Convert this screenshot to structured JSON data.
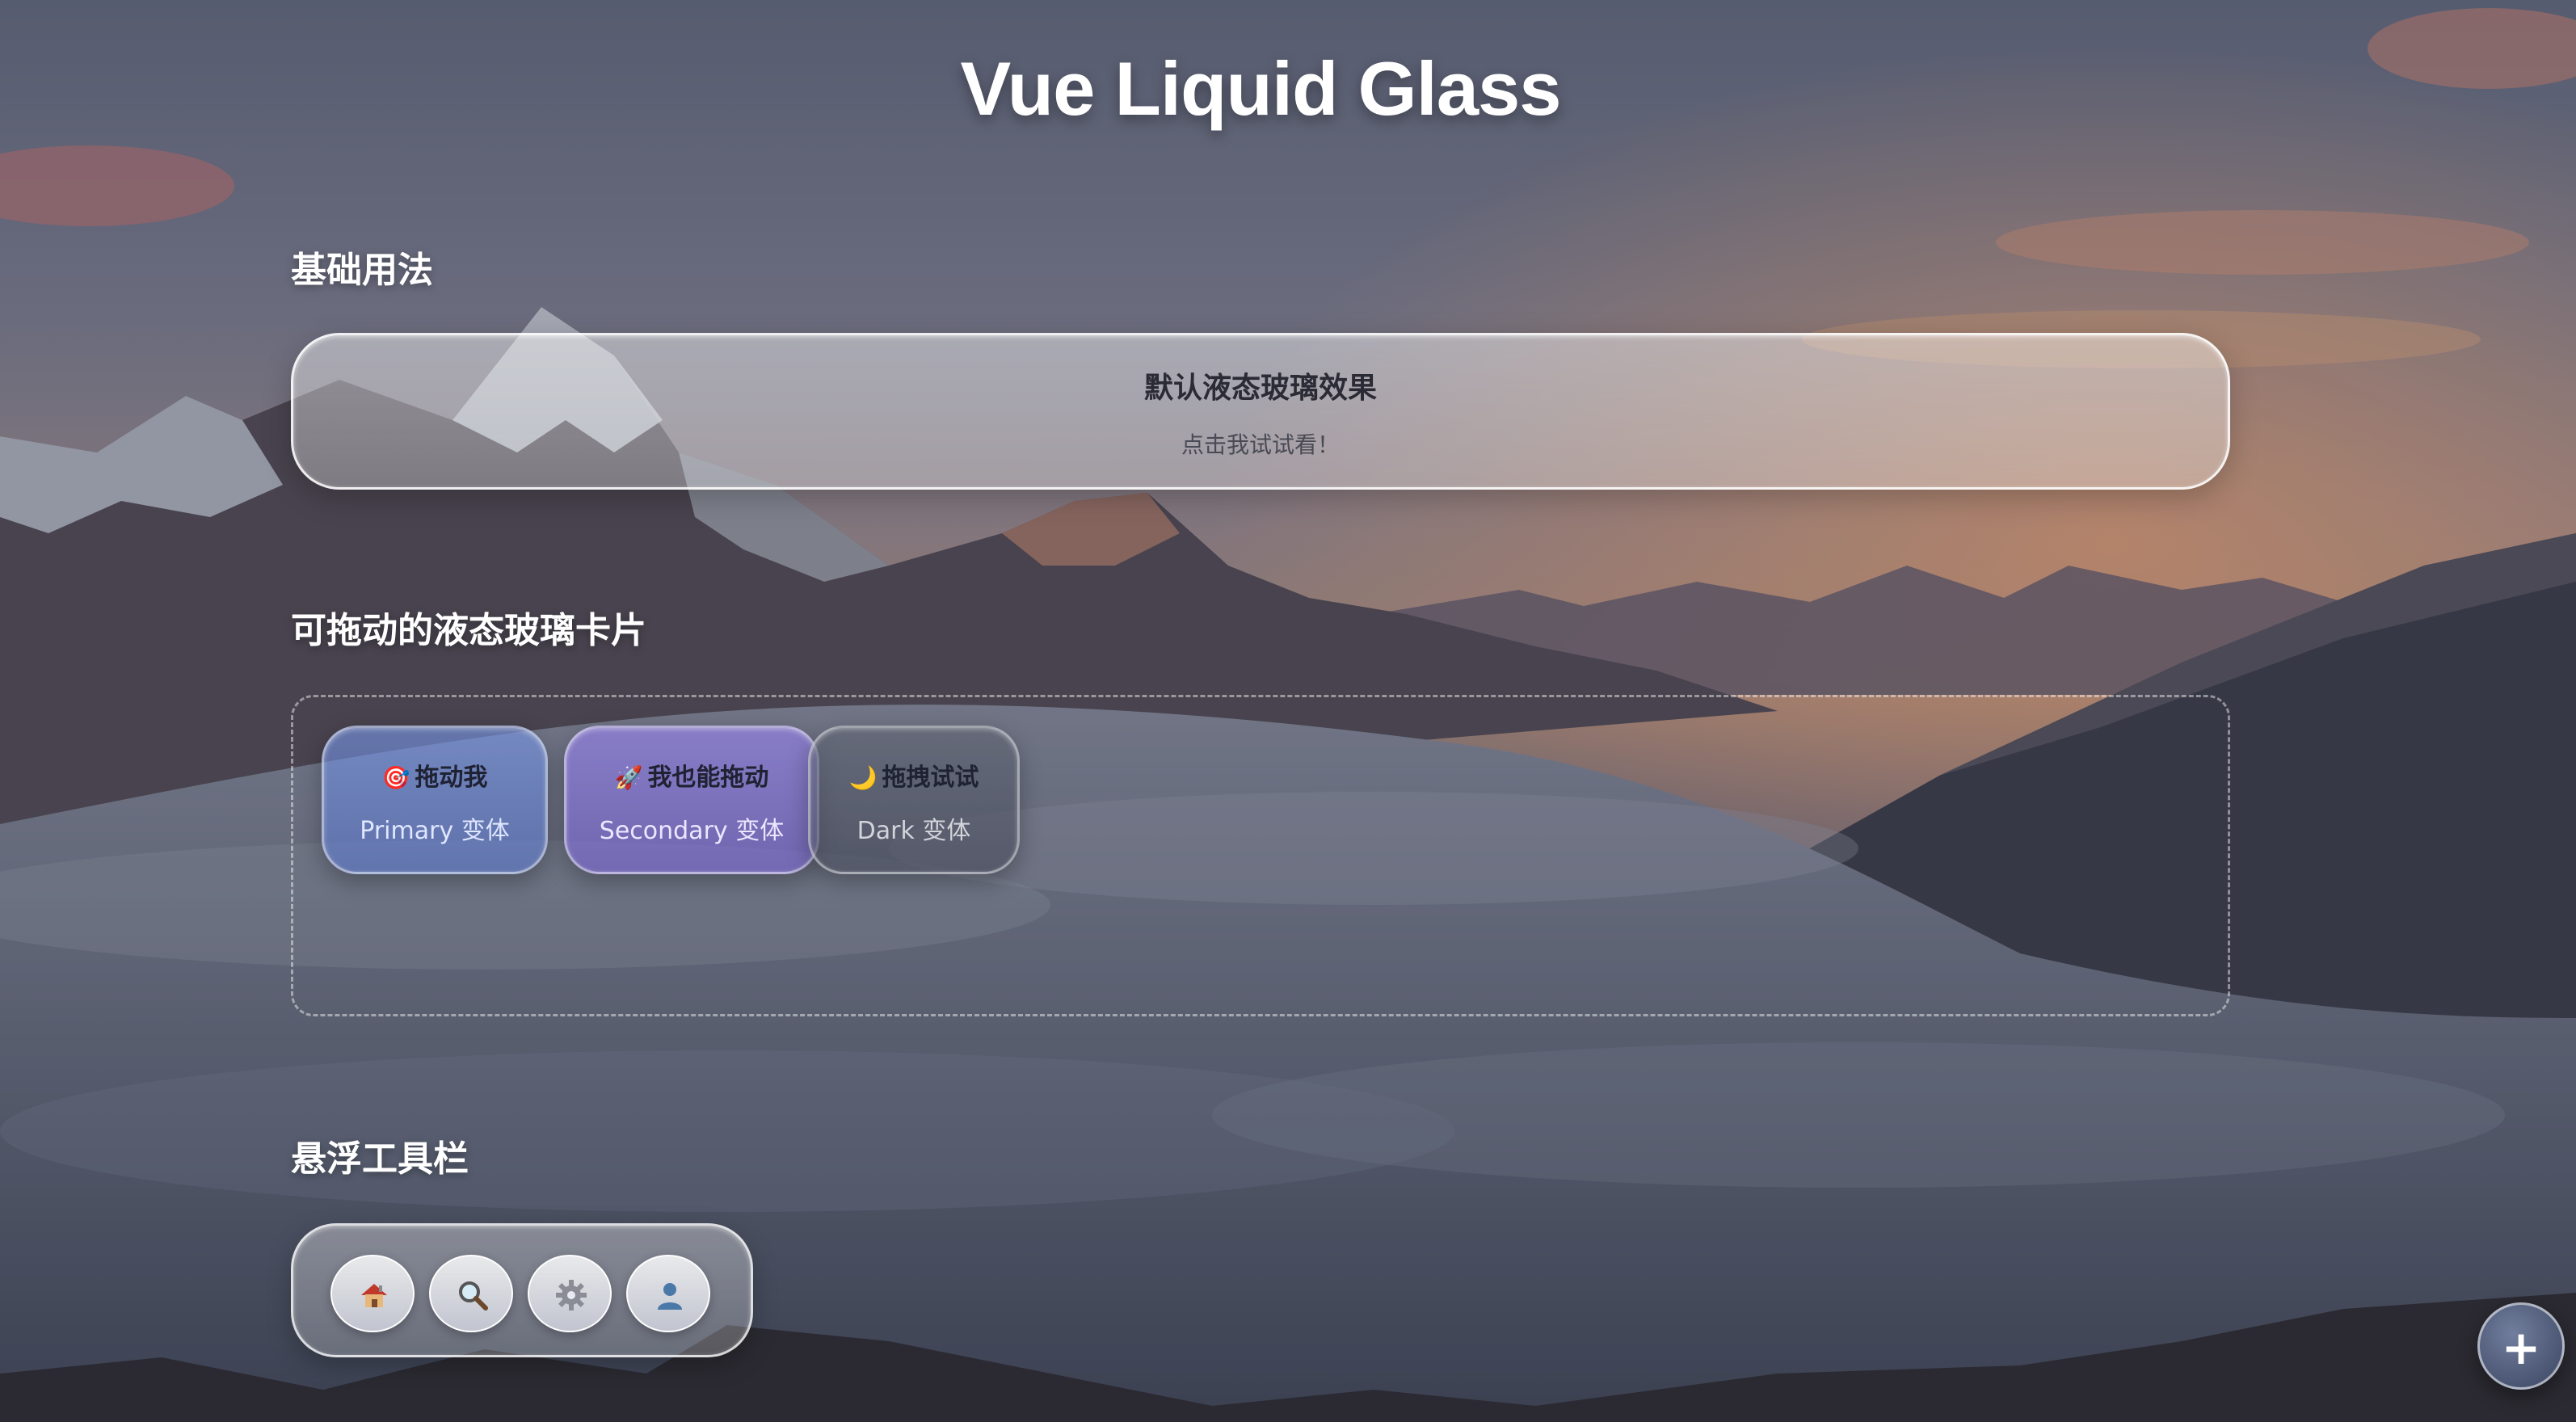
{
  "page": {
    "title": "Vue Liquid Glass"
  },
  "basic_section": {
    "heading": "基础用法",
    "card": {
      "title": "默认液态玻璃效果",
      "subtitle": "点击我试试看！"
    }
  },
  "drag_section": {
    "heading": "可拖动的液态玻璃卡片",
    "cards": [
      {
        "emoji": "🎯",
        "title": "拖动我",
        "subtitle": "Primary 变体",
        "variant": "primary"
      },
      {
        "emoji": "🚀",
        "title": "我也能拖动",
        "subtitle": "Secondary 变体",
        "variant": "secondary"
      },
      {
        "emoji": "🌙",
        "title": "拖拽试试",
        "subtitle": "Dark 变体",
        "variant": "dark"
      }
    ]
  },
  "toolbar_section": {
    "heading": "悬浮工具栏",
    "buttons": [
      {
        "icon": "home-icon"
      },
      {
        "icon": "search-icon"
      },
      {
        "icon": "gear-icon"
      },
      {
        "icon": "user-icon"
      }
    ]
  },
  "fab": {
    "label": "+"
  },
  "colors": {
    "primary": "#7a96e6",
    "secondary": "#9682eb",
    "dark": "#5a5f72",
    "text_light": "#ffffff"
  }
}
